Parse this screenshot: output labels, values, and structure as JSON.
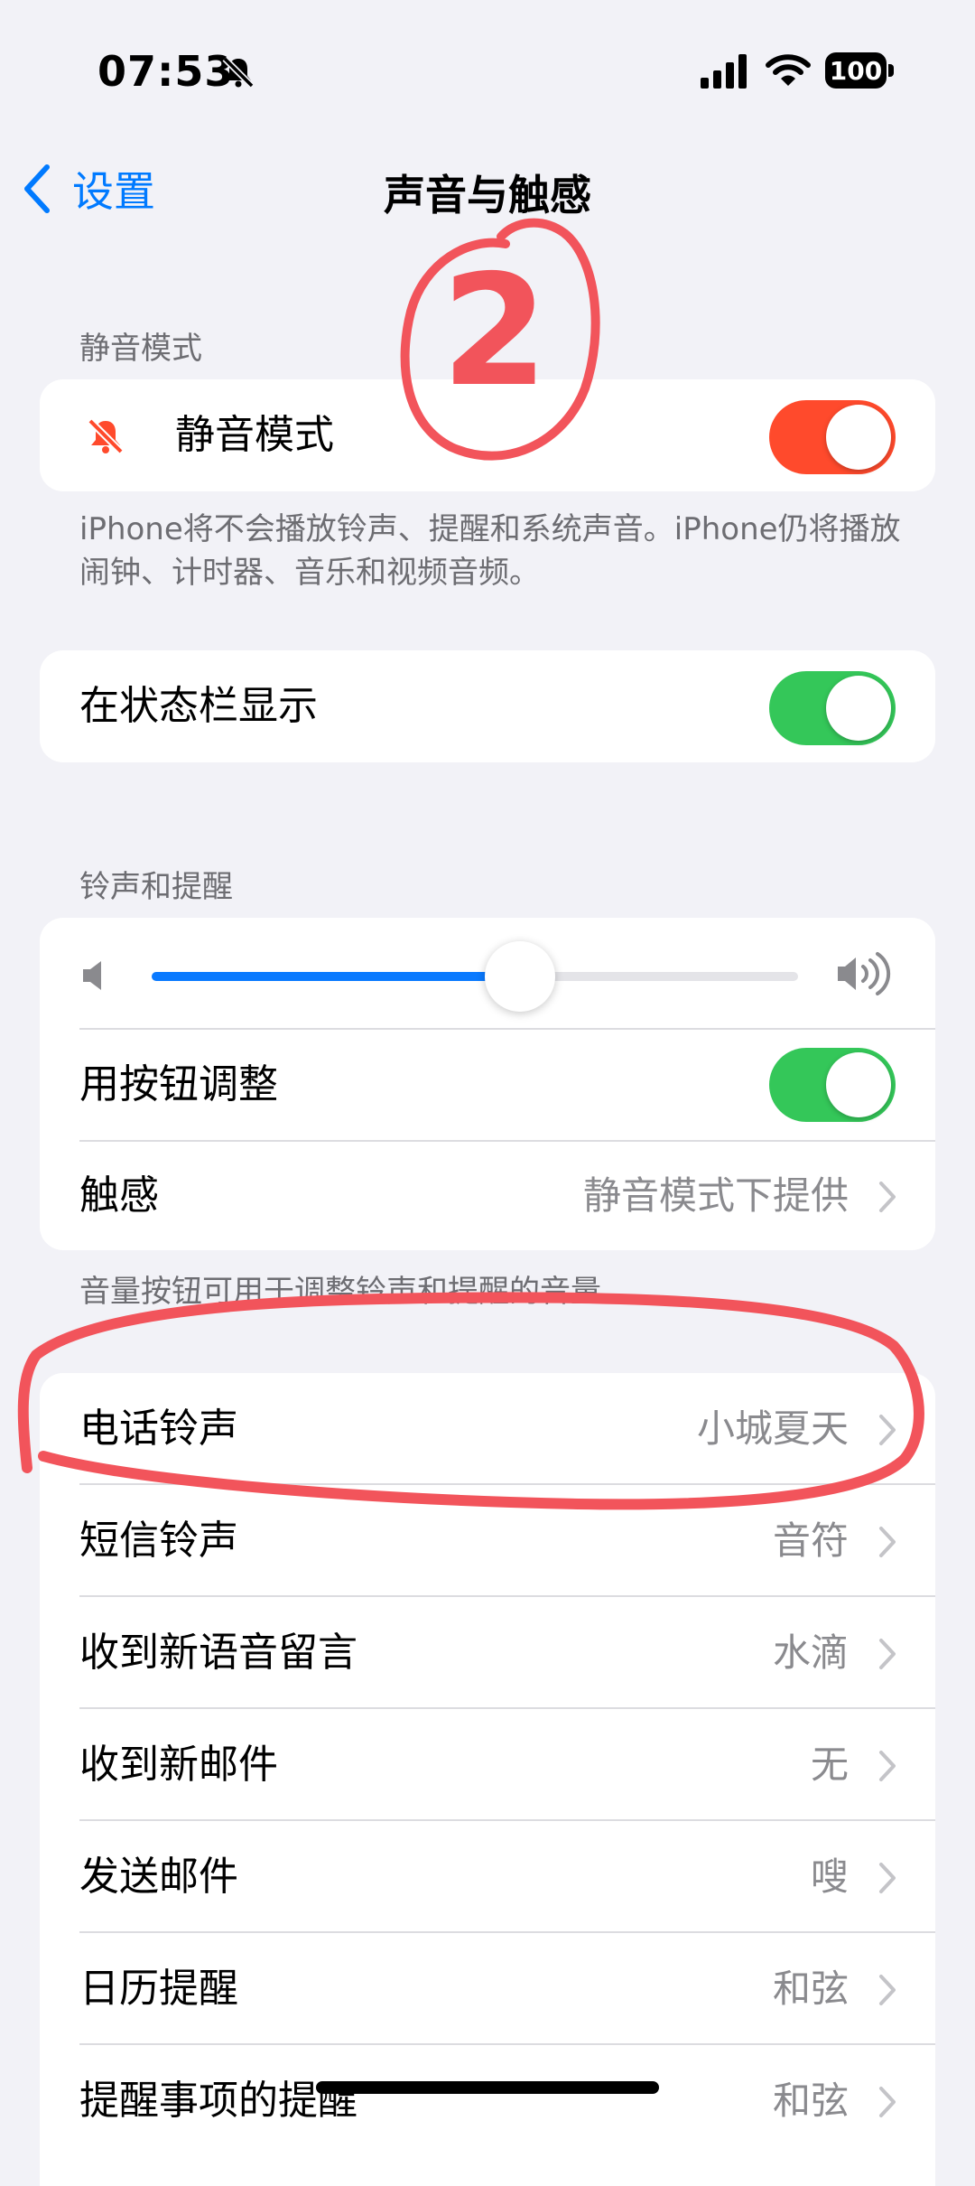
{
  "status_bar": {
    "time": "07:53",
    "battery": "100"
  },
  "nav": {
    "back_label": "设置",
    "title": "声音与触感"
  },
  "silent_section": {
    "header": "静音模式",
    "row_label": "静音模式",
    "toggle_on": true,
    "footer": "iPhone将不会播放铃声、提醒和系统声音。iPhone仍将播放闹钟、计时器、音乐和视频音频。"
  },
  "status_bar_section": {
    "row_label": "在状态栏显示",
    "toggle_on": true
  },
  "ringer_section": {
    "header": "铃声和提醒",
    "volume_level": 0.57,
    "rows": [
      {
        "label": "用按钮调整",
        "toggle_on": true
      },
      {
        "label": "触感",
        "value": "静音模式下提供"
      }
    ],
    "footer": "音量按钮可用于调整铃声和提醒的音量。"
  },
  "sounds_list": [
    {
      "label": "电话铃声",
      "value": "小城夏天"
    },
    {
      "label": "短信铃声",
      "value": "音符"
    },
    {
      "label": "收到新语音留言",
      "value": "水滴"
    },
    {
      "label": "收到新邮件",
      "value": "无"
    },
    {
      "label": "发送邮件",
      "value": "嗖"
    },
    {
      "label": "日历提醒",
      "value": "和弦"
    },
    {
      "label": "提醒事项的提醒",
      "value": "和弦"
    }
  ],
  "annotation": {
    "circled_number": "2",
    "ink_color": "#f2545b"
  },
  "colors": {
    "accent": "#007aff",
    "silent_toggle": "#ff4a2c",
    "toggle_on": "#34c759",
    "slider_fill": "#0a7aff"
  }
}
